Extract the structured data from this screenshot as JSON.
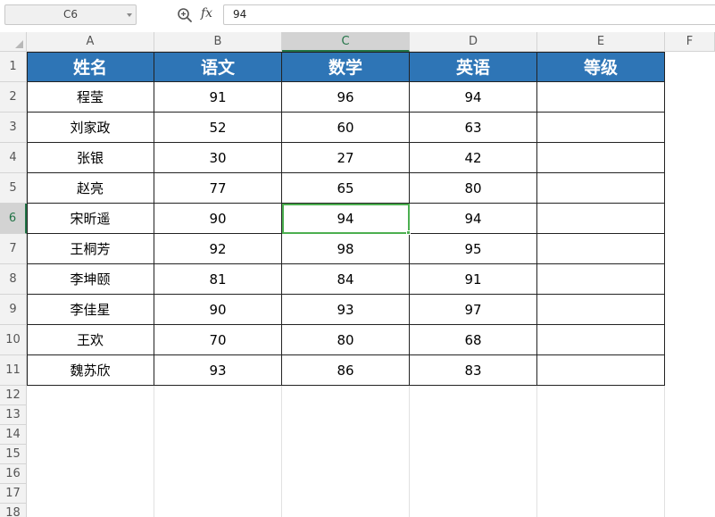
{
  "formula_bar": {
    "name_box": "C6",
    "fx_label": "fx",
    "formula_value": "94"
  },
  "columns": [
    "A",
    "B",
    "C",
    "D",
    "E",
    "F"
  ],
  "rows": [
    "1",
    "2",
    "3",
    "4",
    "5",
    "6",
    "7",
    "8",
    "9",
    "10",
    "11",
    "12",
    "13",
    "14",
    "15",
    "16",
    "17",
    "18"
  ],
  "active_cell": {
    "column": "C",
    "row": "6"
  },
  "table": {
    "headers": [
      "姓名",
      "语文",
      "数学",
      "英语",
      "等级"
    ],
    "rows": [
      [
        "程莹",
        "91",
        "96",
        "94",
        ""
      ],
      [
        "刘家政",
        "52",
        "60",
        "63",
        ""
      ],
      [
        "张银",
        "30",
        "27",
        "42",
        ""
      ],
      [
        "赵亮",
        "77",
        "65",
        "80",
        ""
      ],
      [
        "宋昕遥",
        "90",
        "94",
        "94",
        ""
      ],
      [
        "王桐芳",
        "92",
        "98",
        "95",
        ""
      ],
      [
        "李坤颐",
        "81",
        "84",
        "91",
        ""
      ],
      [
        "李佳星",
        "90",
        "93",
        "97",
        ""
      ],
      [
        "王欢",
        "70",
        "80",
        "68",
        ""
      ],
      [
        "魏苏欣",
        "93",
        "86",
        "83",
        ""
      ]
    ]
  },
  "colors": {
    "header_fill": "#2e75b6",
    "header_text": "#ffffff",
    "selection": "#4caf50",
    "active_header": "#217346"
  },
  "icons": {
    "zoom": "zoom-icon",
    "function": "fx-icon"
  }
}
